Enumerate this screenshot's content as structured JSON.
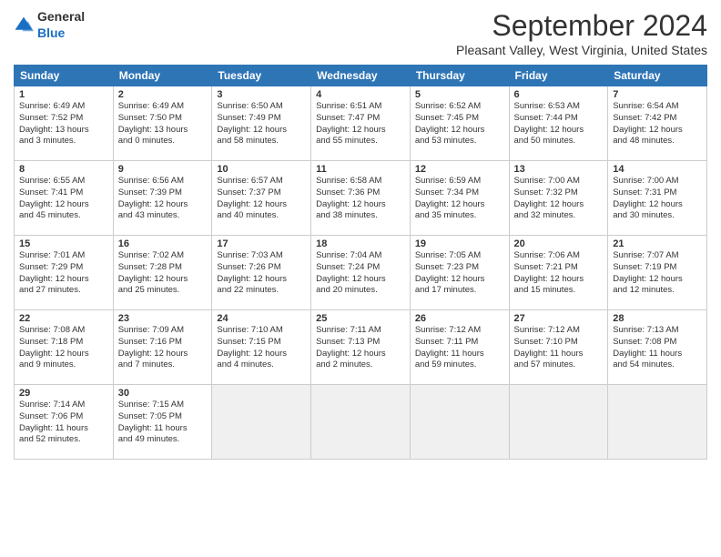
{
  "logo": {
    "general": "General",
    "blue": "Blue"
  },
  "title": "September 2024",
  "location": "Pleasant Valley, West Virginia, United States",
  "days_header": [
    "Sunday",
    "Monday",
    "Tuesday",
    "Wednesday",
    "Thursday",
    "Friday",
    "Saturday"
  ],
  "weeks": [
    [
      {
        "num": "1",
        "info": "Sunrise: 6:49 AM\nSunset: 7:52 PM\nDaylight: 13 hours\nand 3 minutes."
      },
      {
        "num": "2",
        "info": "Sunrise: 6:49 AM\nSunset: 7:50 PM\nDaylight: 13 hours\nand 0 minutes."
      },
      {
        "num": "3",
        "info": "Sunrise: 6:50 AM\nSunset: 7:49 PM\nDaylight: 12 hours\nand 58 minutes."
      },
      {
        "num": "4",
        "info": "Sunrise: 6:51 AM\nSunset: 7:47 PM\nDaylight: 12 hours\nand 55 minutes."
      },
      {
        "num": "5",
        "info": "Sunrise: 6:52 AM\nSunset: 7:45 PM\nDaylight: 12 hours\nand 53 minutes."
      },
      {
        "num": "6",
        "info": "Sunrise: 6:53 AM\nSunset: 7:44 PM\nDaylight: 12 hours\nand 50 minutes."
      },
      {
        "num": "7",
        "info": "Sunrise: 6:54 AM\nSunset: 7:42 PM\nDaylight: 12 hours\nand 48 minutes."
      }
    ],
    [
      {
        "num": "8",
        "info": "Sunrise: 6:55 AM\nSunset: 7:41 PM\nDaylight: 12 hours\nand 45 minutes."
      },
      {
        "num": "9",
        "info": "Sunrise: 6:56 AM\nSunset: 7:39 PM\nDaylight: 12 hours\nand 43 minutes."
      },
      {
        "num": "10",
        "info": "Sunrise: 6:57 AM\nSunset: 7:37 PM\nDaylight: 12 hours\nand 40 minutes."
      },
      {
        "num": "11",
        "info": "Sunrise: 6:58 AM\nSunset: 7:36 PM\nDaylight: 12 hours\nand 38 minutes."
      },
      {
        "num": "12",
        "info": "Sunrise: 6:59 AM\nSunset: 7:34 PM\nDaylight: 12 hours\nand 35 minutes."
      },
      {
        "num": "13",
        "info": "Sunrise: 7:00 AM\nSunset: 7:32 PM\nDaylight: 12 hours\nand 32 minutes."
      },
      {
        "num": "14",
        "info": "Sunrise: 7:00 AM\nSunset: 7:31 PM\nDaylight: 12 hours\nand 30 minutes."
      }
    ],
    [
      {
        "num": "15",
        "info": "Sunrise: 7:01 AM\nSunset: 7:29 PM\nDaylight: 12 hours\nand 27 minutes."
      },
      {
        "num": "16",
        "info": "Sunrise: 7:02 AM\nSunset: 7:28 PM\nDaylight: 12 hours\nand 25 minutes."
      },
      {
        "num": "17",
        "info": "Sunrise: 7:03 AM\nSunset: 7:26 PM\nDaylight: 12 hours\nand 22 minutes."
      },
      {
        "num": "18",
        "info": "Sunrise: 7:04 AM\nSunset: 7:24 PM\nDaylight: 12 hours\nand 20 minutes."
      },
      {
        "num": "19",
        "info": "Sunrise: 7:05 AM\nSunset: 7:23 PM\nDaylight: 12 hours\nand 17 minutes."
      },
      {
        "num": "20",
        "info": "Sunrise: 7:06 AM\nSunset: 7:21 PM\nDaylight: 12 hours\nand 15 minutes."
      },
      {
        "num": "21",
        "info": "Sunrise: 7:07 AM\nSunset: 7:19 PM\nDaylight: 12 hours\nand 12 minutes."
      }
    ],
    [
      {
        "num": "22",
        "info": "Sunrise: 7:08 AM\nSunset: 7:18 PM\nDaylight: 12 hours\nand 9 minutes."
      },
      {
        "num": "23",
        "info": "Sunrise: 7:09 AM\nSunset: 7:16 PM\nDaylight: 12 hours\nand 7 minutes."
      },
      {
        "num": "24",
        "info": "Sunrise: 7:10 AM\nSunset: 7:15 PM\nDaylight: 12 hours\nand 4 minutes."
      },
      {
        "num": "25",
        "info": "Sunrise: 7:11 AM\nSunset: 7:13 PM\nDaylight: 12 hours\nand 2 minutes."
      },
      {
        "num": "26",
        "info": "Sunrise: 7:12 AM\nSunset: 7:11 PM\nDaylight: 11 hours\nand 59 minutes."
      },
      {
        "num": "27",
        "info": "Sunrise: 7:12 AM\nSunset: 7:10 PM\nDaylight: 11 hours\nand 57 minutes."
      },
      {
        "num": "28",
        "info": "Sunrise: 7:13 AM\nSunset: 7:08 PM\nDaylight: 11 hours\nand 54 minutes."
      }
    ],
    [
      {
        "num": "29",
        "info": "Sunrise: 7:14 AM\nSunset: 7:06 PM\nDaylight: 11 hours\nand 52 minutes."
      },
      {
        "num": "30",
        "info": "Sunrise: 7:15 AM\nSunset: 7:05 PM\nDaylight: 11 hours\nand 49 minutes."
      },
      {
        "num": "",
        "info": ""
      },
      {
        "num": "",
        "info": ""
      },
      {
        "num": "",
        "info": ""
      },
      {
        "num": "",
        "info": ""
      },
      {
        "num": "",
        "info": ""
      }
    ]
  ]
}
